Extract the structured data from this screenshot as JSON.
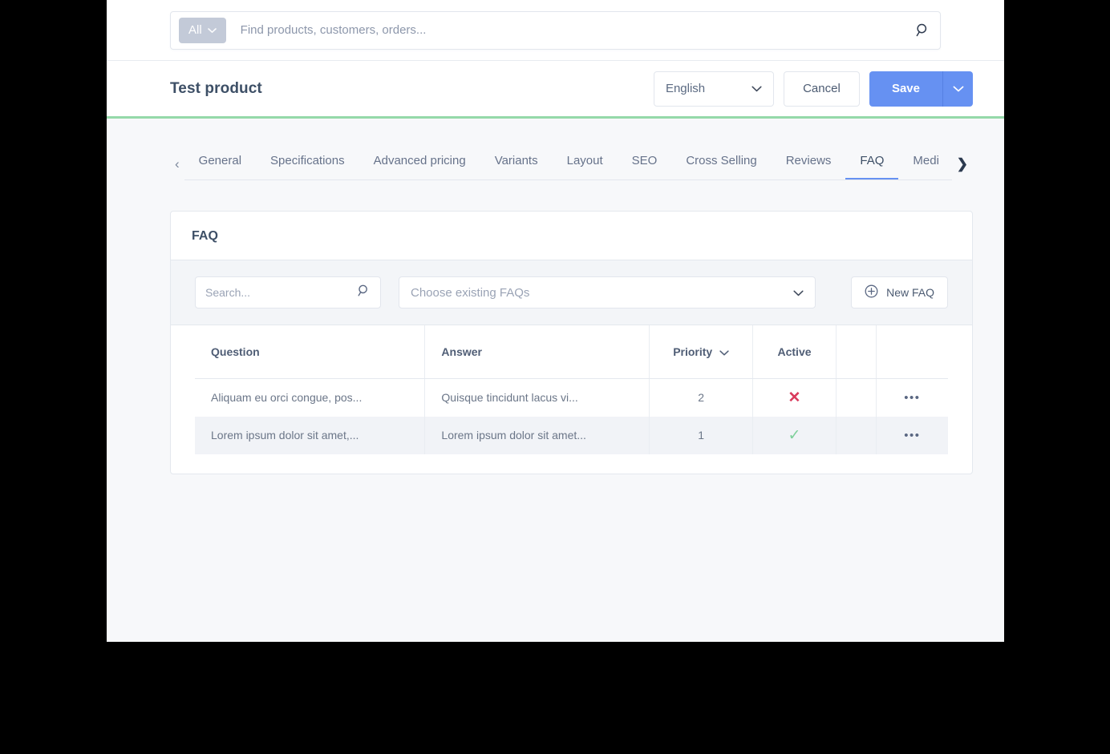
{
  "top_search": {
    "scope_label": "All",
    "placeholder": "Find products, customers, orders...",
    "value": "",
    "search_icon": "search-icon"
  },
  "header": {
    "title": "Test product",
    "language": "English",
    "cancel_label": "Cancel",
    "save_label": "Save",
    "accent_green": "#95d9a9",
    "save_color": "#6691f2"
  },
  "tabs": {
    "prev_arrow": "‹",
    "next_arrow": "❯",
    "items": [
      {
        "label": "General",
        "active": false
      },
      {
        "label": "Specifications",
        "active": false
      },
      {
        "label": "Advanced pricing",
        "active": false
      },
      {
        "label": "Variants",
        "active": false
      },
      {
        "label": "Layout",
        "active": false
      },
      {
        "label": "SEO",
        "active": false
      },
      {
        "label": "Cross Selling",
        "active": false
      },
      {
        "label": "Reviews",
        "active": false
      },
      {
        "label": "FAQ",
        "active": true
      },
      {
        "label": "Medi",
        "active": false
      }
    ]
  },
  "card": {
    "title": "FAQ",
    "toolbar": {
      "search_placeholder": "Search...",
      "search_value": "",
      "select_placeholder": "Choose existing FAQs",
      "new_faq_label": "New FAQ"
    },
    "table": {
      "columns": [
        "Question",
        "Answer",
        "Priority",
        "Active",
        "",
        ""
      ],
      "sort_column": "Priority",
      "rows": [
        {
          "question": "Aliquam eu orci congue, pos...",
          "answer": "Quisque tincidunt lacus vi...",
          "priority": "2",
          "active": false,
          "active_icon": "cross-icon",
          "actions_icon": "•••",
          "highlighted": false
        },
        {
          "question": "Lorem ipsum dolor sit amet,...",
          "answer": "Lorem ipsum dolor sit amet...",
          "priority": "1",
          "active": true,
          "active_icon": "check-icon",
          "actions_icon": "•••",
          "highlighted": true
        }
      ]
    }
  }
}
